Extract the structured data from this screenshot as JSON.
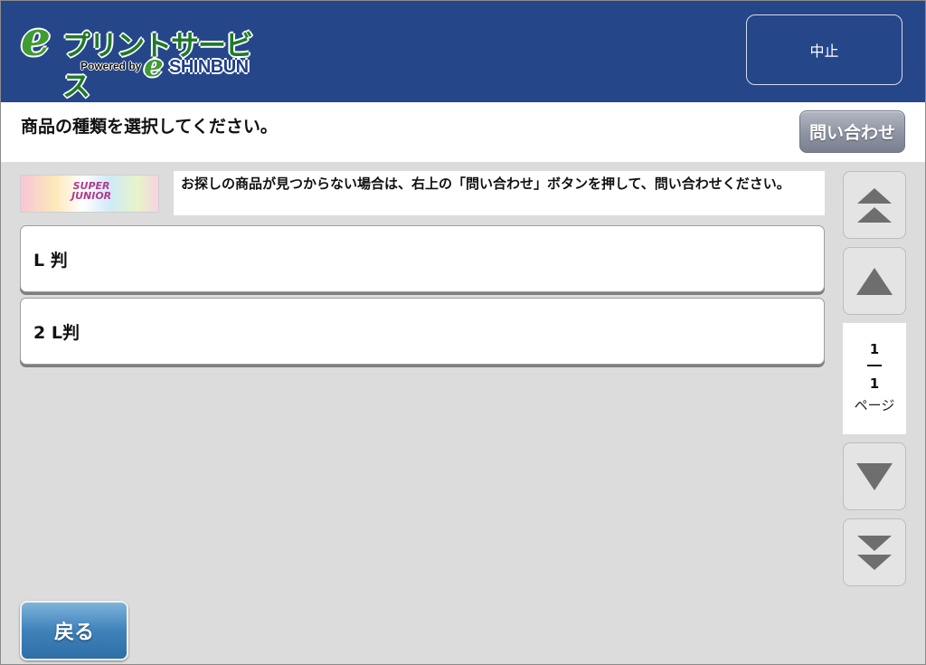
{
  "header": {
    "logo": {
      "e_letter": "e",
      "service_name": "プリントサービス",
      "powered_by": "Powered by",
      "e_letter_small": "e",
      "brand": "SHINBUN",
      "colors": {
        "green": "#3f9b32",
        "navy": "#1f3f8a"
      }
    },
    "cancel_label": "中止",
    "background_color": "#26468a"
  },
  "instruction": "商品の種類を選択してください。",
  "inquiry_label": "問い合わせ",
  "banner": {
    "title_line1": "SUPER",
    "title_line2": "JUNIOR"
  },
  "notice": "お探しの商品が見つからない場合は、右上の「問い合わせ」ボタンを押して、問い合わせください。",
  "products": [
    {
      "label": "L 判"
    },
    {
      "label": "2 L判"
    }
  ],
  "pager": {
    "current": "1",
    "total": "1",
    "unit": "ページ"
  },
  "scroll_icons": [
    "double-chevron-up-icon",
    "chevron-up-icon",
    "chevron-down-icon",
    "double-chevron-down-icon"
  ],
  "back_label": "戻る"
}
